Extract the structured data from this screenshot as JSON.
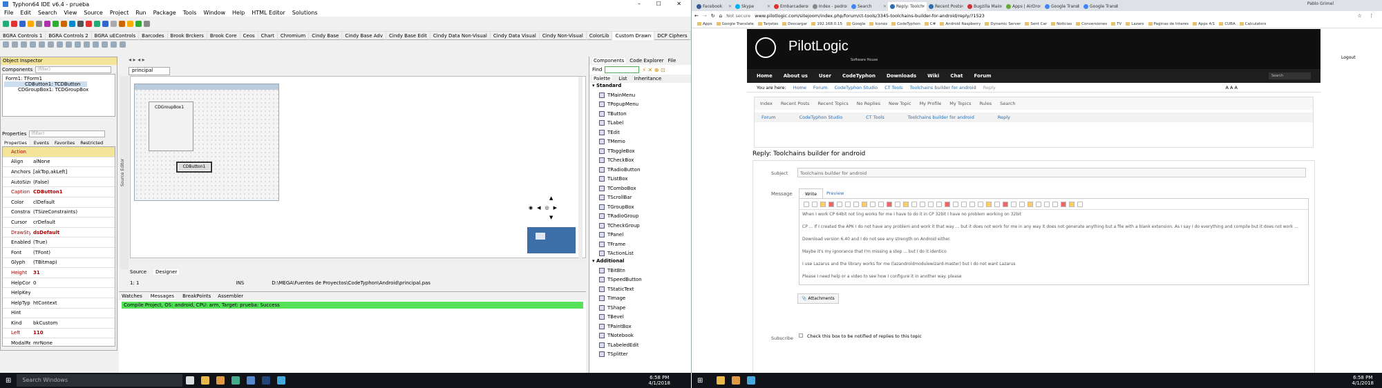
{
  "left": {
    "title": "Typhon64 IDE v6.4 - prueba",
    "menu": [
      "File",
      "Edit",
      "Search",
      "View",
      "Source",
      "Project",
      "Run",
      "Package",
      "Tools",
      "Window",
      "Help",
      "HTML Editor",
      "Solutions"
    ],
    "tabs": [
      "BGRA Controls 1",
      "BGRA Controls 2",
      "BGRA uEControls",
      "Barcodes",
      "Brook Brckers",
      "Brook Core",
      "Ceos",
      "Chart",
      "Chromium",
      "Cindy Base",
      "Cindy Base Adv",
      "Cindy Base Edit",
      "Cindy Data Non-Visual",
      "Cindy Data Visual",
      "Cindy Non-Visual",
      "ColorLib",
      "Custom Drawn",
      "DCP Ciphers"
    ],
    "inspector": {
      "title": "Object Inspector",
      "components_label": "Components",
      "components_filter": "(filter)",
      "tree": [
        "Form1: TForm1",
        "CDButton1: TCDButton",
        "CDGroupBox1: TCDGroupBox"
      ],
      "properties_label": "Properties",
      "properties_filter": "(filter)",
      "prop_tabs": [
        "Properties",
        "Events",
        "Favorites",
        "Restricted"
      ],
      "props": [
        [
          "Action",
          ""
        ],
        [
          "Align",
          "alNone"
        ],
        [
          "Anchors",
          "[akTop,akLeft]"
        ],
        [
          "AutoSize",
          "(False)"
        ],
        [
          "Caption",
          "CDButton1"
        ],
        [
          "Color",
          "clDefault"
        ],
        [
          "Constraints",
          "(TSizeConstraints)"
        ],
        [
          "Cursor",
          "crDefault"
        ],
        [
          "DrawStyle",
          "dsDefault"
        ],
        [
          "Enabled",
          "(True)"
        ],
        [
          "Font",
          "(TFont)"
        ],
        [
          "Glyph",
          "(TBitmap)"
        ],
        [
          "Height",
          "31"
        ],
        [
          "HelpContext",
          "0"
        ],
        [
          "HelpKeyword",
          ""
        ],
        [
          "HelpType",
          "htContext"
        ],
        [
          "Hint",
          ""
        ],
        [
          "Kind",
          "bkCustom"
        ],
        [
          "Left",
          "110"
        ],
        [
          "ModalResult",
          "mrNone"
        ]
      ]
    },
    "editor": {
      "tab": "principal",
      "groupbox": "CDGroupBox1",
      "button": "CDButton1",
      "side_label": "Source Editor",
      "bottom_tabs": [
        "Source",
        "Designer"
      ],
      "status_pos": "1: 1",
      "status_mode": "INS",
      "status_file": "D:\\MEGA\\Fuentes de Proyectos\\CodeTyphon\\Android\\principal.pas"
    },
    "messages": {
      "tabs": [
        "Watches",
        "Messages",
        "BreakPoints",
        "Assembler"
      ],
      "line": "Compile Project, OS: android, CPU: arm, Target: prueba: Success"
    },
    "palette": {
      "tabs": [
        "Components",
        "Code Explorer",
        "File"
      ],
      "find_label": "Find",
      "subtabs": [
        "Palette",
        "List",
        "Inheritance"
      ],
      "standard_label": "Standard",
      "standard": [
        "TMainMenu",
        "TPopupMenu",
        "TButton",
        "TLabel",
        "TEdit",
        "TMemo",
        "TToggleBox",
        "TCheckBox",
        "TRadioButton",
        "TListBox",
        "TComboBox",
        "TScrollBar",
        "TGroupBox",
        "TRadioGroup",
        "TCheckGroup",
        "TPanel",
        "TFrame",
        "TActionList"
      ],
      "additional_label": "Additional",
      "additional": [
        "TBitBtn",
        "TSpeedButton",
        "TStaticText",
        "TImage",
        "TShape",
        "TBevel",
        "TPaintBox",
        "TNotebook",
        "TLabeledEdit",
        "TSplitter"
      ]
    }
  },
  "taskbar_left": {
    "search": "Search Windows",
    "time": "6:58 PM",
    "date": "4/1/2018"
  },
  "right": {
    "tabs": [
      "Facebook",
      "Skype",
      "Embarcadero",
      "Index - pedro",
      "Search",
      "Reply: Toolch",
      "Recent Posts",
      "Bugzilla Main",
      "Apps | AirDro",
      "Google Transl",
      "Google Transl"
    ],
    "active_tab": 5,
    "window_user": "Pablo Grimel",
    "security": "Not secure",
    "url": "www.pilotlogic.com/sitejoom/index.php/forum/ct-tools/3345-toolchains-builder-for-android/reply/?1523",
    "bookmarks": [
      "Apps",
      "Google Translate",
      "Tarjetas",
      "Descargar",
      "192.168.0.15",
      "Google",
      "Iconos",
      "CodeTyphon",
      "C#",
      "Android Raspberry",
      "Dynamic Server",
      "Sent Car",
      "Noticias",
      "Conversiones",
      "TV",
      "Lazaro",
      "Paginas de Interes",
      "Apps 4/1",
      "CUBA",
      "Calculators"
    ],
    "site": {
      "brand": "PilotLogic",
      "tagline": "Software House",
      "nav": [
        "Home",
        "About us",
        "User",
        "CodeTyphon",
        "Downloads",
        "Wiki",
        "Chat",
        "Forum"
      ],
      "search_placeholder": "Search",
      "you_are_here": "You are here:",
      "crumbs": [
        "Home",
        "Forum",
        "CodeTyphon Studio",
        "CT Tools",
        "Toolchains builder for android",
        "Reply"
      ],
      "font_sizes": "A A A",
      "logout": "Logout",
      "forum_menu": [
        "Index",
        "Recent Posts",
        "Recent Topics",
        "No Replies",
        "New Topic",
        "My Profile",
        "My Topics",
        "Rules",
        "Search"
      ],
      "path": [
        "Forum",
        "CodeTyphon Studio",
        "CT Tools",
        "Toolchains builder for android",
        "Reply"
      ],
      "heading": "Reply: Toolchains builder for android",
      "subject_label": "Subject",
      "subject_value": "Toolchains builder for android",
      "message_label": "Message",
      "write_tab": "Write",
      "preview_tab": "Preview",
      "body": [
        "When I work CP 64bit not ling works for me I have to do it in CP 32bit I have no problem working on 32bit",
        "CP ... If I created the APK I do not have any problem and work it that way ... but it does not work for me in any way it does not generate anything but a file with a blank extension. As I say I do everything and compile but it does not work ...",
        "Download version 6.40 and I do not see any strength on Android either.",
        "Maybe it's my ignorance that I'm missing a step ... but I do it identico",
        "I use Lazarus and the library works for me (lazandroidmodulewizard-master) but I do not want Lazarus",
        "Please I need help or a video to see how I configure it in another way. please"
      ],
      "attachments": "Attachments",
      "subscribe_label": "Subscribe",
      "subscribe_text": "Check this box to be notified of replies to this topic"
    }
  },
  "taskbar_right": {
    "time": "6:58 PM",
    "date": "4/1/2018"
  }
}
